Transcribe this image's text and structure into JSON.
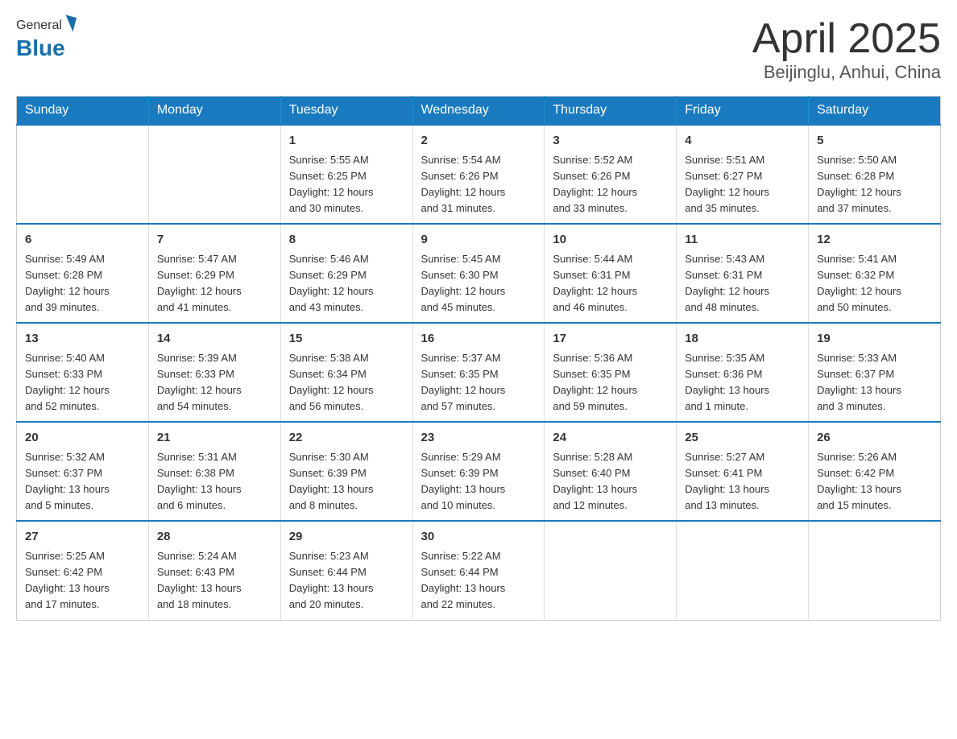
{
  "header": {
    "logo_general": "General",
    "logo_blue": "Blue",
    "title": "April 2025",
    "subtitle": "Beijinglu, Anhui, China"
  },
  "calendar": {
    "days_of_week": [
      "Sunday",
      "Monday",
      "Tuesday",
      "Wednesday",
      "Thursday",
      "Friday",
      "Saturday"
    ],
    "weeks": [
      [
        {
          "day": "",
          "info": ""
        },
        {
          "day": "",
          "info": ""
        },
        {
          "day": "1",
          "info": "Sunrise: 5:55 AM\nSunset: 6:25 PM\nDaylight: 12 hours\nand 30 minutes."
        },
        {
          "day": "2",
          "info": "Sunrise: 5:54 AM\nSunset: 6:26 PM\nDaylight: 12 hours\nand 31 minutes."
        },
        {
          "day": "3",
          "info": "Sunrise: 5:52 AM\nSunset: 6:26 PM\nDaylight: 12 hours\nand 33 minutes."
        },
        {
          "day": "4",
          "info": "Sunrise: 5:51 AM\nSunset: 6:27 PM\nDaylight: 12 hours\nand 35 minutes."
        },
        {
          "day": "5",
          "info": "Sunrise: 5:50 AM\nSunset: 6:28 PM\nDaylight: 12 hours\nand 37 minutes."
        }
      ],
      [
        {
          "day": "6",
          "info": "Sunrise: 5:49 AM\nSunset: 6:28 PM\nDaylight: 12 hours\nand 39 minutes."
        },
        {
          "day": "7",
          "info": "Sunrise: 5:47 AM\nSunset: 6:29 PM\nDaylight: 12 hours\nand 41 minutes."
        },
        {
          "day": "8",
          "info": "Sunrise: 5:46 AM\nSunset: 6:29 PM\nDaylight: 12 hours\nand 43 minutes."
        },
        {
          "day": "9",
          "info": "Sunrise: 5:45 AM\nSunset: 6:30 PM\nDaylight: 12 hours\nand 45 minutes."
        },
        {
          "day": "10",
          "info": "Sunrise: 5:44 AM\nSunset: 6:31 PM\nDaylight: 12 hours\nand 46 minutes."
        },
        {
          "day": "11",
          "info": "Sunrise: 5:43 AM\nSunset: 6:31 PM\nDaylight: 12 hours\nand 48 minutes."
        },
        {
          "day": "12",
          "info": "Sunrise: 5:41 AM\nSunset: 6:32 PM\nDaylight: 12 hours\nand 50 minutes."
        }
      ],
      [
        {
          "day": "13",
          "info": "Sunrise: 5:40 AM\nSunset: 6:33 PM\nDaylight: 12 hours\nand 52 minutes."
        },
        {
          "day": "14",
          "info": "Sunrise: 5:39 AM\nSunset: 6:33 PM\nDaylight: 12 hours\nand 54 minutes."
        },
        {
          "day": "15",
          "info": "Sunrise: 5:38 AM\nSunset: 6:34 PM\nDaylight: 12 hours\nand 56 minutes."
        },
        {
          "day": "16",
          "info": "Sunrise: 5:37 AM\nSunset: 6:35 PM\nDaylight: 12 hours\nand 57 minutes."
        },
        {
          "day": "17",
          "info": "Sunrise: 5:36 AM\nSunset: 6:35 PM\nDaylight: 12 hours\nand 59 minutes."
        },
        {
          "day": "18",
          "info": "Sunrise: 5:35 AM\nSunset: 6:36 PM\nDaylight: 13 hours\nand 1 minute."
        },
        {
          "day": "19",
          "info": "Sunrise: 5:33 AM\nSunset: 6:37 PM\nDaylight: 13 hours\nand 3 minutes."
        }
      ],
      [
        {
          "day": "20",
          "info": "Sunrise: 5:32 AM\nSunset: 6:37 PM\nDaylight: 13 hours\nand 5 minutes."
        },
        {
          "day": "21",
          "info": "Sunrise: 5:31 AM\nSunset: 6:38 PM\nDaylight: 13 hours\nand 6 minutes."
        },
        {
          "day": "22",
          "info": "Sunrise: 5:30 AM\nSunset: 6:39 PM\nDaylight: 13 hours\nand 8 minutes."
        },
        {
          "day": "23",
          "info": "Sunrise: 5:29 AM\nSunset: 6:39 PM\nDaylight: 13 hours\nand 10 minutes."
        },
        {
          "day": "24",
          "info": "Sunrise: 5:28 AM\nSunset: 6:40 PM\nDaylight: 13 hours\nand 12 minutes."
        },
        {
          "day": "25",
          "info": "Sunrise: 5:27 AM\nSunset: 6:41 PM\nDaylight: 13 hours\nand 13 minutes."
        },
        {
          "day": "26",
          "info": "Sunrise: 5:26 AM\nSunset: 6:42 PM\nDaylight: 13 hours\nand 15 minutes."
        }
      ],
      [
        {
          "day": "27",
          "info": "Sunrise: 5:25 AM\nSunset: 6:42 PM\nDaylight: 13 hours\nand 17 minutes."
        },
        {
          "day": "28",
          "info": "Sunrise: 5:24 AM\nSunset: 6:43 PM\nDaylight: 13 hours\nand 18 minutes."
        },
        {
          "day": "29",
          "info": "Sunrise: 5:23 AM\nSunset: 6:44 PM\nDaylight: 13 hours\nand 20 minutes."
        },
        {
          "day": "30",
          "info": "Sunrise: 5:22 AM\nSunset: 6:44 PM\nDaylight: 13 hours\nand 22 minutes."
        },
        {
          "day": "",
          "info": ""
        },
        {
          "day": "",
          "info": ""
        },
        {
          "day": "",
          "info": ""
        }
      ]
    ]
  }
}
